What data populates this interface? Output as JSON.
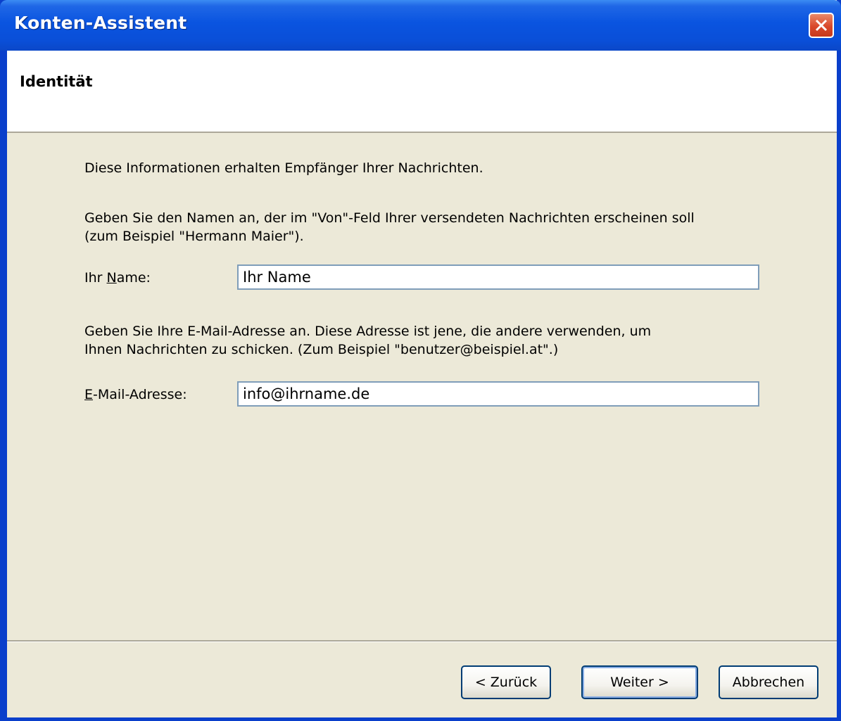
{
  "window": {
    "title": "Konten-Assistent"
  },
  "header": {
    "title": "Identität"
  },
  "content": {
    "intro": "Diese Informationen erhalten Empfänger Ihrer Nachrichten.",
    "name_hint_line1": "Geben Sie den Namen an, der im \"Von\"-Feld Ihrer versendeten Nachrichten erscheinen soll",
    "name_hint_line2": "(zum Beispiel \"Hermann Maier\").",
    "name_label_pre": "Ihr ",
    "name_label_accel": "N",
    "name_label_post": "ame:",
    "name_value": "Ihr Name",
    "email_hint_line1": "Geben Sie Ihre E-Mail-Adresse an. Diese Adresse ist jene, die andere verwenden, um",
    "email_hint_line2": "Ihnen Nachrichten zu schicken. (Zum Beispiel \"benutzer@beispiel.at\".)",
    "email_label_accel": "E",
    "email_label_post": "-Mail-Adresse:",
    "email_value": "info@ihrname.de"
  },
  "buttons": {
    "back": "< Zurück",
    "next": "Weiter >",
    "cancel": "Abbrechen"
  },
  "colors": {
    "titlebar": "#0a54e0",
    "dialog_bg": "#ece9d8",
    "close_button": "#d9482a"
  },
  "icons": {
    "close": "close-icon"
  }
}
